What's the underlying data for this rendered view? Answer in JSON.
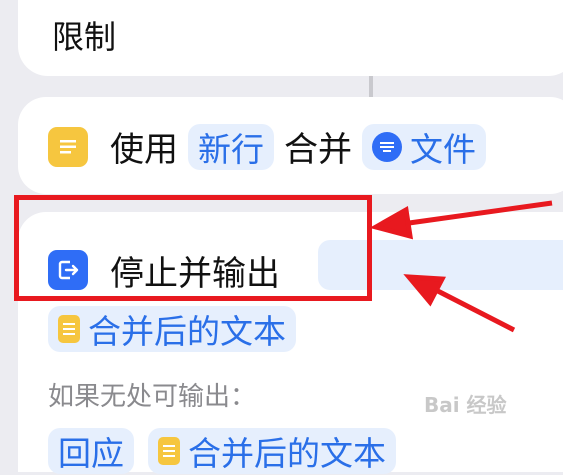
{
  "top_card": {
    "label": "限制"
  },
  "combine_action": {
    "word_use": "使用",
    "token_newline": "新行",
    "word_combine": "合并",
    "token_file": "文件"
  },
  "stop_action": {
    "title": "停止并输出",
    "output_token": "合并后的文本",
    "if_nowhere_label": "如果无处可输出：",
    "option_reply": "回应",
    "option_text": "合并后的文本"
  },
  "watermark": "Bai 经验",
  "colors": {
    "highlight": "#e8191f",
    "token_blue": "#2a6fe8",
    "doc_yellow": "#f6c63f"
  }
}
